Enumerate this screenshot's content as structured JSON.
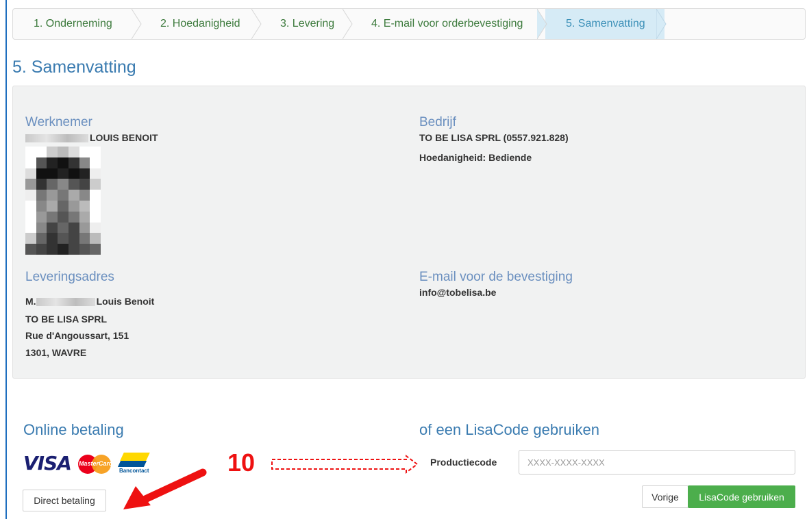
{
  "wizard": {
    "steps": [
      {
        "label": "1. Onderneming"
      },
      {
        "label": "2. Hoedanigheid"
      },
      {
        "label": "3. Levering"
      },
      {
        "label": "4. E-mail voor orderbevestiging"
      },
      {
        "label": "5. Samenvatting"
      }
    ]
  },
  "page": {
    "title": "5. Samenvatting"
  },
  "summary": {
    "employee_heading": "Werknemer",
    "employee_name": "LOUIS BENOIT",
    "company_heading": "Bedrijf",
    "company_name": "TO BE LISA SPRL (0557.921.828)",
    "capacity": "Hoedanigheid: Bediende",
    "delivery_heading": "Leveringsadres",
    "delivery_name_prefix": "M.",
    "delivery_name": "Louis Benoit",
    "delivery_company": "TO BE LISA SPRL",
    "delivery_street": "Rue d'Angoussart, 151",
    "delivery_city": "1301, WAVRE",
    "email_heading": "E-mail voor de bevestiging",
    "email": "info@tobelisa.be"
  },
  "payment": {
    "online_heading": "Online betaling",
    "visa_label": "VISA",
    "mastercard_label": "MasterCard",
    "bancontact_label": "Bancontact",
    "direct_button": "Direct betaling",
    "lisacode_heading": "of een LisaCode gebruiken",
    "product_code_label": "Productiecode",
    "product_code_placeholder": "XXXX-XXXX-XXXX",
    "back_button": "Vorige",
    "use_code_button": "LisaCode gebruiken"
  },
  "annotation": {
    "number": "10"
  },
  "colors": {
    "accent": "#3a7bb0",
    "green": "#4cae4c",
    "annotation": "#e11111"
  }
}
